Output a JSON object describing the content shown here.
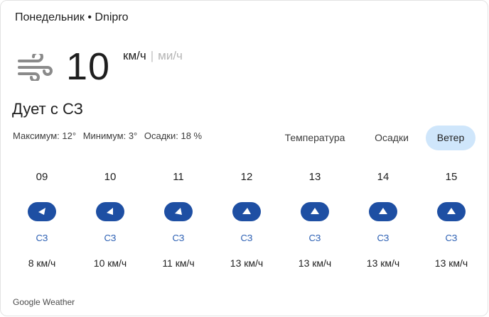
{
  "header": {
    "title": "Понедельник • Dnipro"
  },
  "current": {
    "icon": "wind-icon",
    "value": "10",
    "unit_active": "км/ч",
    "unit_separator": "|",
    "unit_inactive": "ми/ч",
    "condition": "Дует с СЗ"
  },
  "stats": {
    "max": "Максимум: 12°",
    "min": "Минимум: 3°",
    "precip": "Осадки: 18 %"
  },
  "tabs": {
    "temperature": "Температура",
    "precipitation": "Осадки",
    "wind": "Ветер",
    "selected": "wind"
  },
  "hours": [
    {
      "time": "09",
      "direction": "СЗ",
      "speed": "8 км/ч"
    },
    {
      "time": "10",
      "direction": "СЗ",
      "speed": "10 км/ч"
    },
    {
      "time": "11",
      "direction": "СЗ",
      "speed": "11 км/ч"
    },
    {
      "time": "12",
      "direction": "СЗ",
      "speed": "13 км/ч"
    },
    {
      "time": "13",
      "direction": "СЗ",
      "speed": "13 км/ч"
    },
    {
      "time": "14",
      "direction": "СЗ",
      "speed": "13 км/ч"
    },
    {
      "time": "15",
      "direction": "СЗ",
      "speed": "13 км/ч"
    }
  ],
  "colors": {
    "pill": "#1e4fa3",
    "direction_text": "#2b5fb3",
    "selected_tab_bg": "#cfe6fb"
  },
  "footer": {
    "source": "Google Weather"
  }
}
